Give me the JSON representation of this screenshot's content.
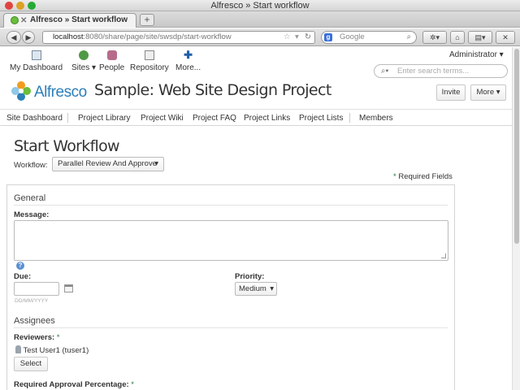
{
  "window": {
    "title": "Alfresco » Start workflow"
  },
  "tabs": [
    {
      "label": "Alfresco » Start workflow"
    }
  ],
  "browser": {
    "url_host": "localhost",
    "url_rest": ":8080/share/page/site/swsdp/start-workflow",
    "search_engine": "Google"
  },
  "header": {
    "nav": [
      {
        "label": "My Dashboard",
        "icon": "dashboard-icon"
      },
      {
        "label": "Sites",
        "icon": "globe-icon"
      },
      {
        "label": "People",
        "icon": "people-icon"
      },
      {
        "label": "Repository",
        "icon": "repository-icon"
      },
      {
        "label": "More...",
        "icon": "plus-icon"
      }
    ],
    "user": "Administrator",
    "search_placeholder": "Enter search terms...",
    "logo_text": "Alfresco",
    "site_title": "Sample: Web Site Design Project",
    "invite_label": "Invite",
    "more_label": "More"
  },
  "sitenav": [
    "Site Dashboard",
    "Project Library",
    "Project Wiki",
    "Project FAQ",
    "Project Links",
    "Project Lists",
    "Members"
  ],
  "form": {
    "page_title": "Start Workflow",
    "workflow_label": "Workflow:",
    "workflow_value": "Parallel Review And Approve",
    "required_note": "Required Fields",
    "general_title": "General",
    "message_label": "Message:",
    "due_label": "Due:",
    "due_hint": "DD/MM/YYYY",
    "priority_label": "Priority:",
    "priority_value": "Medium",
    "assignees_title": "Assignees",
    "reviewers_label": "Reviewers:",
    "reviewer_name": "Test User1 (tuser1)",
    "select_label": "Select",
    "approval_label": "Required Approval Percentage:"
  },
  "colors": {
    "accent": "#2c7fb8",
    "required": "#2a7a3a",
    "logo_green": "#6bbd3b"
  }
}
